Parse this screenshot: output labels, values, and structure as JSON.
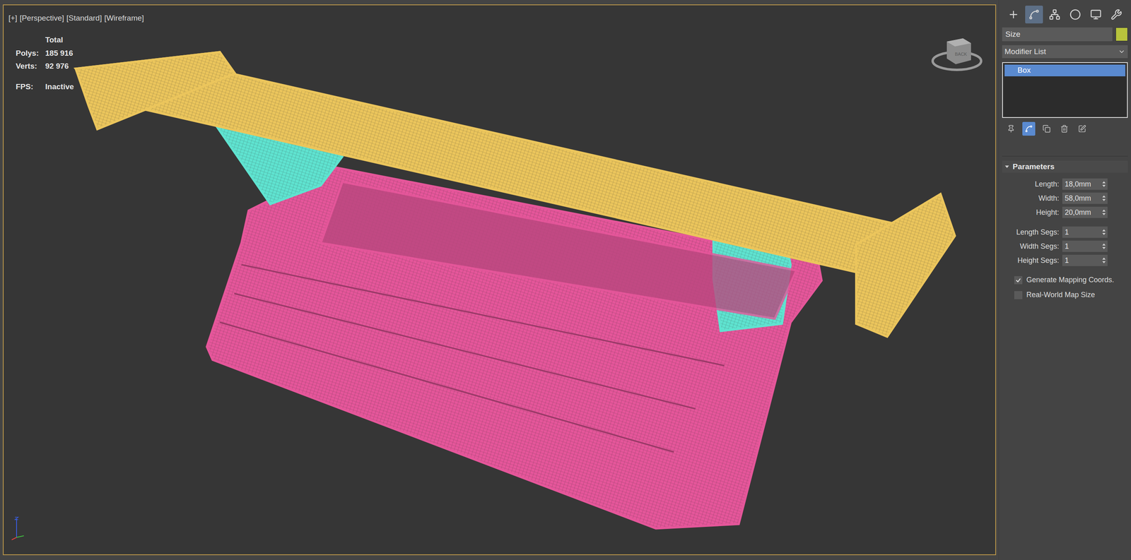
{
  "viewport": {
    "labels": [
      "[+]",
      "[Perspective]",
      "[Standard]",
      "[Wireframe]"
    ],
    "active": true,
    "stats": {
      "header": "Total",
      "rows": [
        {
          "label": "Polys:",
          "value": "185 916"
        },
        {
          "label": "Verts:",
          "value": "92 976"
        }
      ],
      "fps_label": "FPS:",
      "fps_value": "Inactive"
    },
    "meshes": [
      {
        "kind": "body",
        "color": "#e5569a"
      },
      {
        "kind": "supports",
        "color": "#5fe3d0"
      },
      {
        "kind": "wing",
        "color": "#ebc55c"
      }
    ],
    "viewcube": {
      "label": "BACK"
    }
  },
  "command_panel": {
    "tabs": [
      {
        "kind": "create",
        "selected": false
      },
      {
        "kind": "modify",
        "selected": true
      },
      {
        "kind": "hierarchy",
        "selected": false
      },
      {
        "kind": "motion",
        "selected": false
      },
      {
        "kind": "display",
        "selected": false
      },
      {
        "kind": "utilities",
        "selected": false
      }
    ],
    "name_field": {
      "value": "Size",
      "color": "#b8c43c"
    },
    "modifier_list": {
      "label": "Modifier List"
    },
    "stack": [
      {
        "label": "Box",
        "selected": true
      }
    ],
    "stack_tools": [
      {
        "kind": "pin",
        "selected": false
      },
      {
        "kind": "show-end",
        "selected": true
      },
      {
        "kind": "unique",
        "selected": false
      },
      {
        "kind": "remove",
        "selected": false
      },
      {
        "kind": "configure",
        "selected": false
      }
    ],
    "rollout": {
      "title": "Parameters",
      "expanded": true,
      "params": [
        {
          "label": "Length:",
          "value": "18,0mm"
        },
        {
          "label": "Width:",
          "value": "58,0mm"
        },
        {
          "label": "Height:",
          "value": "20,0mm"
        },
        {
          "label": "Length Segs:",
          "value": "1"
        },
        {
          "label": "Width Segs:",
          "value": "1"
        },
        {
          "label": "Height Segs:",
          "value": "1"
        }
      ],
      "checkboxes": [
        {
          "label": "Generate Mapping Coords.",
          "checked": true
        },
        {
          "label": "Real-World Map Size",
          "checked": false
        }
      ]
    }
  }
}
